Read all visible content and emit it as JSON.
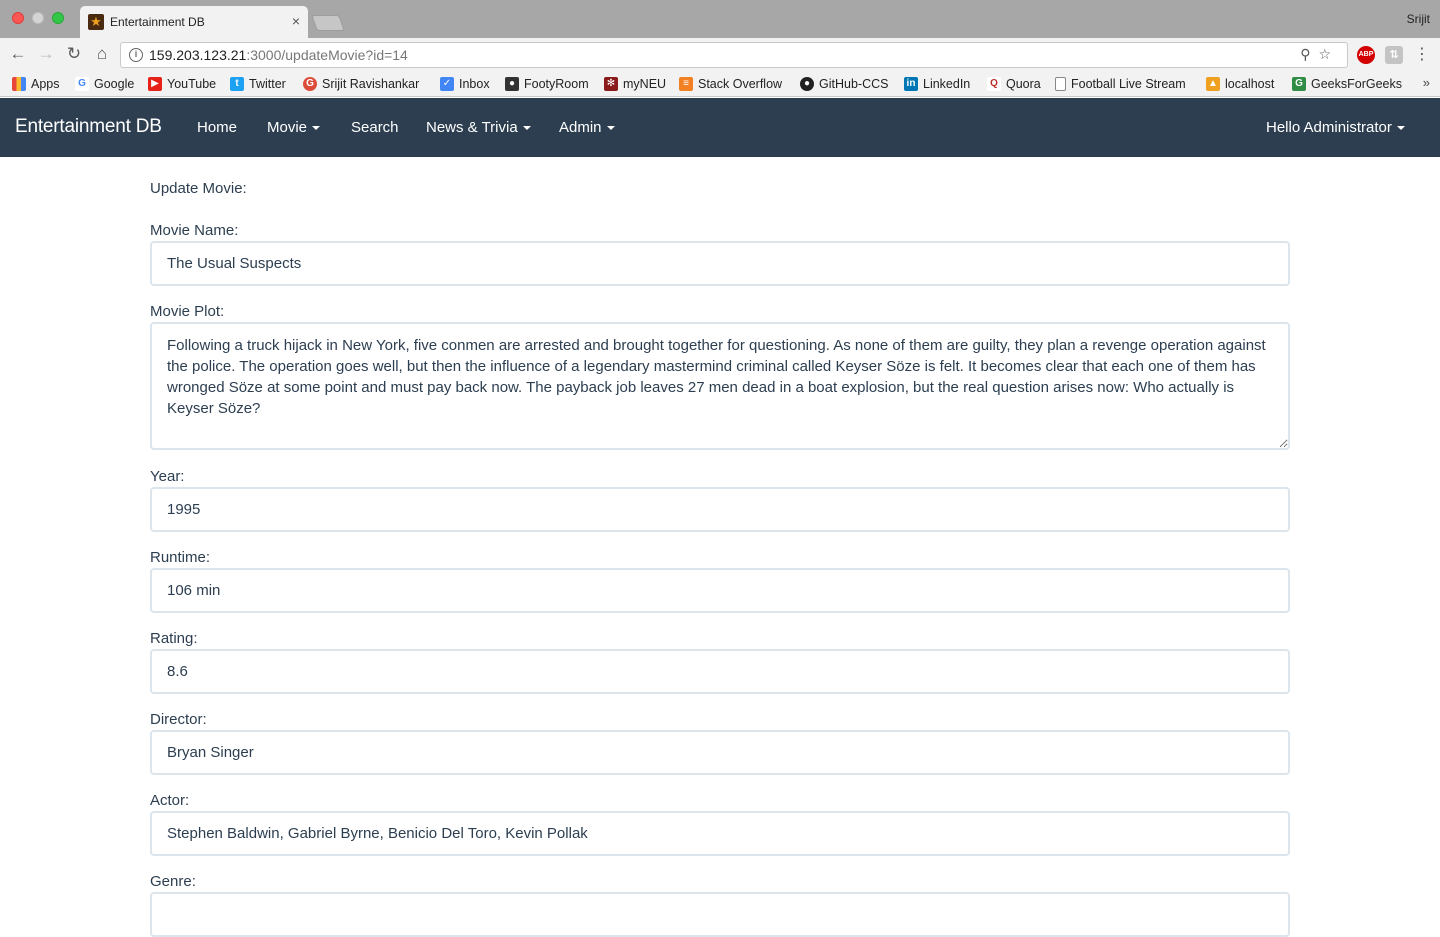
{
  "browser": {
    "tab_title": "Entertainment DB",
    "tab_close": "×",
    "profile_name": "Srijit",
    "url_host": "159.203.123.21",
    "url_rest": ":3000/updateMovie?id=14",
    "bookmarks": [
      {
        "label": "Apps",
        "icon": "apps-grid-icon",
        "color": "#e8453c"
      },
      {
        "label": "Google",
        "icon": "google-icon",
        "color": "#4285f4"
      },
      {
        "label": "YouTube",
        "icon": "youtube-icon",
        "color": "#e62117"
      },
      {
        "label": "Twitter",
        "icon": "twitter-icon",
        "color": "#1da1f2"
      },
      {
        "label": "Srijit Ravishankar",
        "icon": "google-plus-icon",
        "color": "#dd4b39"
      },
      {
        "label": "Inbox",
        "icon": "inbox-icon",
        "color": "#4285f4"
      },
      {
        "label": "FootyRoom",
        "icon": "footyroom-icon",
        "color": "#333333"
      },
      {
        "label": "myNEU",
        "icon": "paw-icon",
        "color": "#8b1a1a"
      },
      {
        "label": "Stack Overflow",
        "icon": "stackoverflow-icon",
        "color": "#f48024"
      },
      {
        "label": "GitHub-CCS",
        "icon": "github-icon",
        "color": "#222222"
      },
      {
        "label": "LinkedIn",
        "icon": "linkedin-icon",
        "color": "#0077b5"
      },
      {
        "label": "Quora",
        "icon": "quora-icon",
        "color": "#b92b27"
      },
      {
        "label": "Football Live Stream",
        "icon": "page-icon",
        "color": "#ffffff"
      },
      {
        "label": "localhost",
        "icon": "localhost-icon",
        "color": "#f0a020"
      },
      {
        "label": "GeeksForGeeks",
        "icon": "geeksforgeeks-icon",
        "color": "#2f8d46"
      }
    ],
    "bookmarks_more": "»"
  },
  "navbar": {
    "brand": "Entertainment DB",
    "home": "Home",
    "movie": "Movie",
    "search": "Search",
    "news": "News & Trivia",
    "admin": "Admin",
    "user": "Hello Administrator",
    "bg_color": "#2c3e50"
  },
  "form": {
    "title": "Update Movie:",
    "movie_name_label": "Movie Name:",
    "movie_name_value": "The Usual Suspects",
    "plot_label": "Movie Plot:",
    "plot_value": "Following a truck hijack in New York, five conmen are arrested and brought together for questioning. As none of them are guilty, they plan a revenge operation against the police. The operation goes well, but then the influence of a legendary mastermind criminal called Keyser Söze is felt. It becomes clear that each one of them has wronged Söze at some point and must pay back now. The payback job leaves 27 men dead in a boat explosion, but the real question arises now: Who actually is Keyser Söze?",
    "year_label": "Year:",
    "year_value": "1995",
    "runtime_label": "Runtime:",
    "runtime_value": "106 min",
    "rating_label": "Rating:",
    "rating_value": "8.6",
    "director_label": "Director:",
    "director_value": "Bryan Singer",
    "actor_label": "Actor:",
    "actor_value": "Stephen Baldwin, Gabriel Byrne, Benicio Del Toro, Kevin Pollak",
    "genre_label": "Genre:",
    "genre_value": ""
  }
}
